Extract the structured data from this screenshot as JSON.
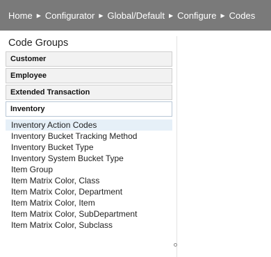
{
  "breadcrumb": {
    "items": [
      "Home",
      "Configurator",
      "Global/Default",
      "Configure",
      "Codes"
    ],
    "separator": "▶"
  },
  "panel": {
    "title": "Code Groups",
    "groups": [
      "Customer",
      "Employee",
      "Extended Transaction",
      "Inventory"
    ],
    "active_group": "Inventory",
    "items": [
      "Inventory Action Codes",
      "Inventory Bucket Tracking Method",
      "Inventory Bucket Type",
      "Inventory System Bucket Type",
      "Item Group",
      "Item Matrix Color, Class",
      "Item Matrix Color, Department",
      "Item Matrix Color, Item",
      "Item Matrix Color, SubDepartment",
      "Item Matrix Color, Subclass"
    ],
    "selected_item": "Inventory Action Codes"
  },
  "colors": {
    "header_bg": "#7a7a7a",
    "selected_bg": "#e6f0f8"
  }
}
